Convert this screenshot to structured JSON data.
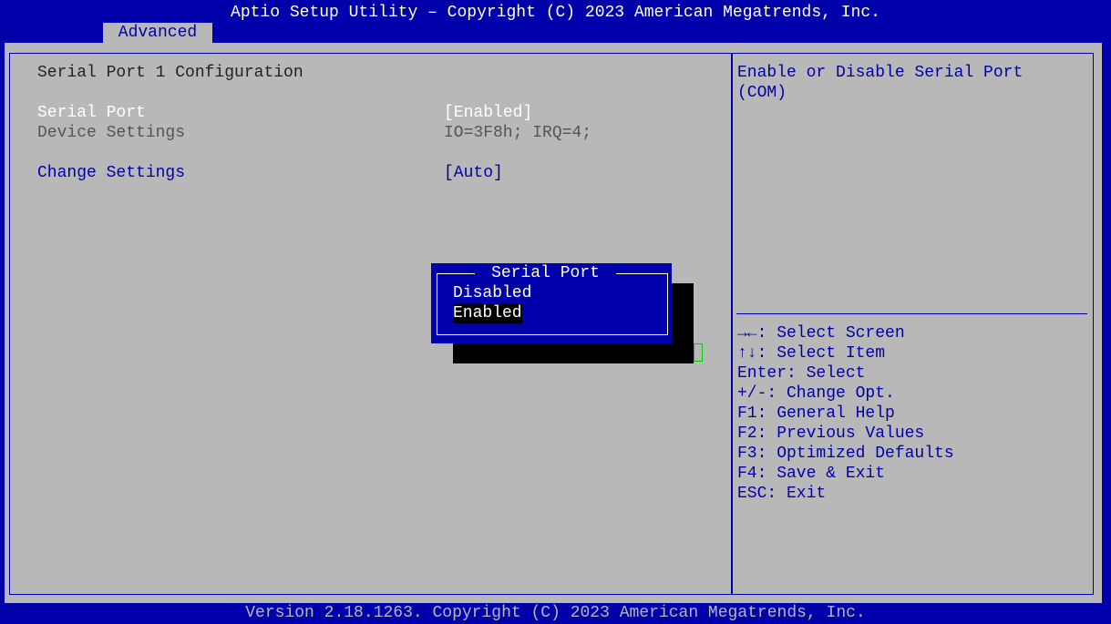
{
  "header": {
    "title": "Aptio Setup Utility – Copyright (C) 2023 American Megatrends, Inc.",
    "active_tab": "Advanced"
  },
  "main": {
    "section_title": "Serial Port 1 Configuration",
    "rows": [
      {
        "label": "Serial Port",
        "value": "[Enabled]"
      },
      {
        "label": "Device Settings",
        "value": "IO=3F8h; IRQ=4;"
      },
      {
        "label": "Change Settings",
        "value": "[Auto]"
      }
    ]
  },
  "help": {
    "description": "Enable or Disable Serial Port\n(COM)",
    "keys": [
      "→←: Select Screen",
      "↑↓: Select Item",
      "Enter: Select",
      "+/-: Change Opt.",
      "F1: General Help",
      "F2: Previous Values",
      "F3: Optimized Defaults",
      "F4: Save & Exit",
      "ESC: Exit"
    ]
  },
  "popup": {
    "title": "Serial Port",
    "options": [
      "Disabled",
      "Enabled"
    ],
    "selected": "Enabled"
  },
  "footer": {
    "version": "Version 2.18.1263. Copyright (C) 2023 American Megatrends, Inc."
  },
  "colors": {
    "bios_blue": "#0000aa",
    "panel_grey": "#b8b8b8",
    "highlight_white": "#ffffff"
  }
}
